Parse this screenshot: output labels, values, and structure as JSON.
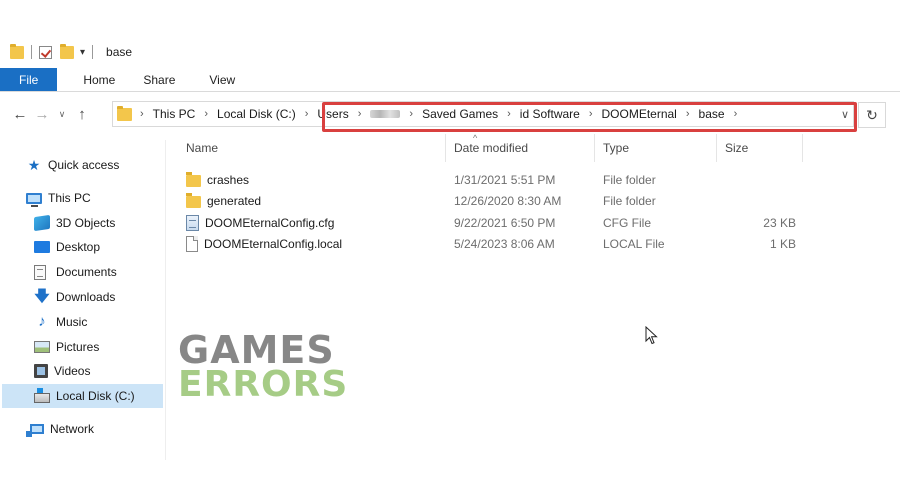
{
  "window": {
    "title": "base"
  },
  "ribbon": {
    "tabs": [
      "File",
      "Home",
      "Share",
      "View"
    ]
  },
  "address": {
    "crumbs": [
      "This PC",
      "Local Disk (C:)",
      "Users",
      "",
      "Saved Games",
      "id Software",
      "DOOMEternal",
      "base"
    ],
    "highlight_color": "#d9403f"
  },
  "sidebar": {
    "items": [
      {
        "label": "Quick access",
        "icon": "star-icon"
      },
      {
        "label": "This PC",
        "icon": "computer-icon"
      },
      {
        "label": "3D Objects",
        "icon": "cube-icon"
      },
      {
        "label": "Desktop",
        "icon": "desktop-icon"
      },
      {
        "label": "Documents",
        "icon": "document-icon"
      },
      {
        "label": "Downloads",
        "icon": "download-arrow-icon"
      },
      {
        "label": "Music",
        "icon": "music-note-icon"
      },
      {
        "label": "Pictures",
        "icon": "picture-icon"
      },
      {
        "label": "Videos",
        "icon": "film-icon"
      },
      {
        "label": "Local Disk (C:)",
        "icon": "drive-icon",
        "selected": true
      },
      {
        "label": "Network",
        "icon": "network-icon"
      }
    ]
  },
  "filelist": {
    "columns": [
      "Name",
      "Date modified",
      "Type",
      "Size"
    ],
    "rows": [
      {
        "name": "crashes",
        "date": "1/31/2021 5:51 PM",
        "type": "File folder",
        "size": "",
        "icon": "folder-icon"
      },
      {
        "name": "generated",
        "date": "12/26/2020 8:30 AM",
        "type": "File folder",
        "size": "",
        "icon": "folder-icon"
      },
      {
        "name": "DOOMEternalConfig.cfg",
        "date": "9/22/2021 6:50 PM",
        "type": "CFG File",
        "size": "23 KB",
        "icon": "config-file-icon"
      },
      {
        "name": "DOOMEternalConfig.local",
        "date": "5/24/2023 8:06 AM",
        "type": "LOCAL File",
        "size": "1 KB",
        "icon": "blank-file-icon"
      }
    ]
  },
  "watermark": {
    "line1": "GAMES",
    "line2": "ERRORS"
  },
  "colors": {
    "accent": "#1a6fc4",
    "selection": "#cce4f7",
    "folder": "#f3c64b"
  }
}
